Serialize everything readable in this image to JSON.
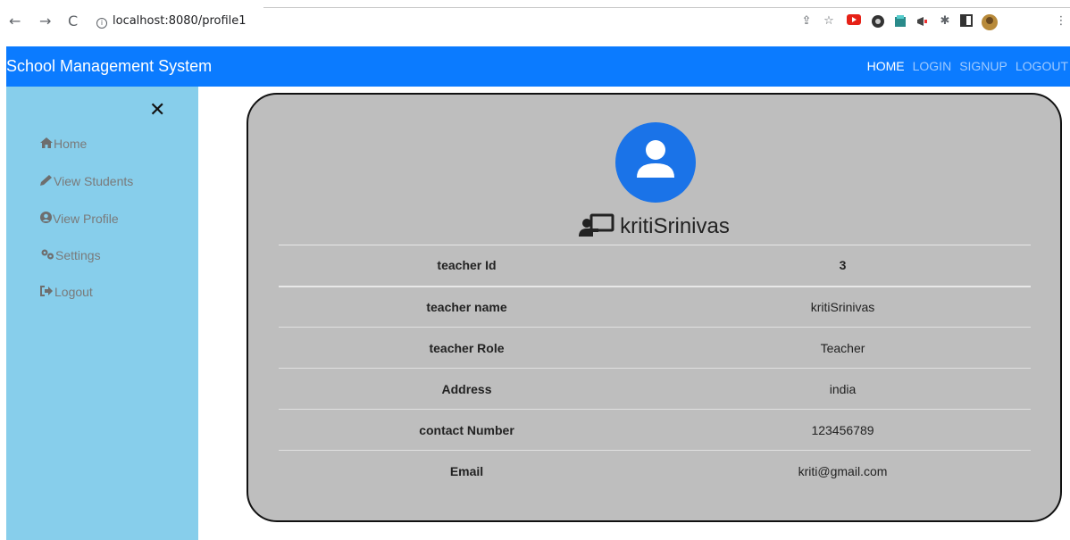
{
  "browser": {
    "back": "←",
    "forward": "→",
    "reload": "C",
    "url": "localhost:8080/profile1"
  },
  "navbar": {
    "brand": "School Management System",
    "links": [
      "HOME",
      "LOGIN",
      "SIGNUP",
      "LOGOUT"
    ]
  },
  "sidebar": {
    "close": "✕",
    "items": [
      {
        "label": "Home",
        "icon": "home-icon"
      },
      {
        "label": "View Students",
        "icon": "pencil-icon"
      },
      {
        "label": "View Profile",
        "icon": "user-circle-icon"
      },
      {
        "label": "Settings",
        "icon": "cogs-icon"
      },
      {
        "label": "Logout",
        "icon": "sign-out-icon"
      }
    ]
  },
  "profile": {
    "name": "kritiSrinivas",
    "rows": [
      {
        "key": "teacher Id",
        "value": "3"
      },
      {
        "key": "teacher name",
        "value": "kritiSrinivas"
      },
      {
        "key": "teacher Role",
        "value": "Teacher"
      },
      {
        "key": "Address",
        "value": "india"
      },
      {
        "key": "contact Number",
        "value": "123456789"
      },
      {
        "key": "Email",
        "value": "kriti@gmail.com"
      }
    ]
  },
  "colors": {
    "navbar": "#0b7bff",
    "sidebar": "#87ceeb",
    "card": "#bebebe",
    "avatar": "#1a73e8"
  }
}
